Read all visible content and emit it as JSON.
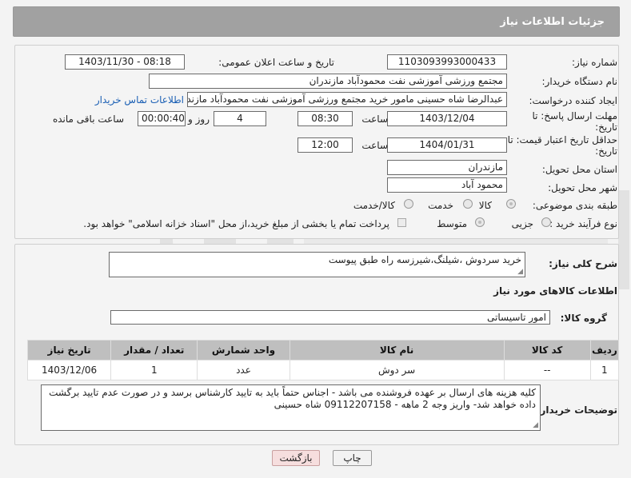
{
  "header": {
    "title": "جزئیات اطلاعات نیاز"
  },
  "fields": {
    "need_number_label": "شماره نیاز:",
    "need_number": "1103093993000433",
    "announce_label": "تاریخ و ساعت اعلان عمومی:",
    "announce_value": "1403/11/30 - 08:18",
    "buyer_org_label": "نام دستگاه خریدار:",
    "buyer_org": "مجتمع ورزشی آموزشی نفت محمودآباد مازندران",
    "requester_label": "ایجاد کننده درخواست:",
    "requester": "عبدالرضا شاه حسینی مامور خرید مجتمع ورزشی آموزشی نفت محمودآباد مازندران",
    "contact_link": "اطلاعات تماس خریدار",
    "deadline_label_1": "مهلت ارسال پاسخ: تا",
    "deadline_label_2": "تاریخ:",
    "deadline_date": "1403/12/04",
    "time_label": "ساعت",
    "deadline_time": "08:30",
    "days_value": "4",
    "days_label": "روز و",
    "remaining_value": "00:00:40",
    "remaining_label": "ساعت باقی مانده",
    "validity_label_1": "حداقل تاریخ اعتبار قیمت: تا",
    "validity_label_2": "تاریخ:",
    "validity_date": "1404/01/31",
    "validity_time": "12:00",
    "province_label": "استان محل تحویل:",
    "province": "مازندران",
    "city_label": "شهر محل تحویل:",
    "city": "محمود آباد",
    "category_label": "طبقه بندی موضوعی:",
    "category_options": [
      "کالا",
      "خدمت",
      "کالا/خدمت"
    ],
    "category_selected": "کالا",
    "process_label": "نوع فرآیند خرید :",
    "process_options": [
      "جزیی",
      "متوسط"
    ],
    "process_selected": "متوسط",
    "payment_note": "پرداخت تمام یا بخشی از مبلغ خرید،از محل \"اسناد خزانه اسلامی\" خواهد بود."
  },
  "summary": {
    "label": "شرح کلی نیاز:",
    "value": "خرید سردوش ،شیلنگ،شیرزسه راه طبق پیوست"
  },
  "goods_section_title": "اطلاعات کالاهای مورد نیاز",
  "goods_group": {
    "label": "گروه کالا:",
    "value": "امور تاسیساتی"
  },
  "table": {
    "headers": [
      "ردیف",
      "کد کالا",
      "نام کالا",
      "واحد شمارش",
      "تعداد / مقدار",
      "تاریخ نیاز"
    ],
    "rows": [
      [
        "1",
        "--",
        "سر دوش",
        "عدد",
        "1",
        "1403/12/06"
      ]
    ]
  },
  "buyer_notes": {
    "label": "توضیحات خریدار:",
    "value": "کلیه هزینه های ارسال بر عهده فروشنده می باشد - اجناس حتماً باید به تایید کارشناس برسد و در صورت عدم تایید برگشت داده خواهد شد- واریز وجه 2 ماهه - 09112207158 شاه حسینی"
  },
  "buttons": {
    "print": "چاپ",
    "back": "بازگشت"
  },
  "colors": {
    "header": "#a1a1a1",
    "link": "#1a5fb4",
    "table_header": "#bfbfbf",
    "back_button": "#f6dede"
  }
}
